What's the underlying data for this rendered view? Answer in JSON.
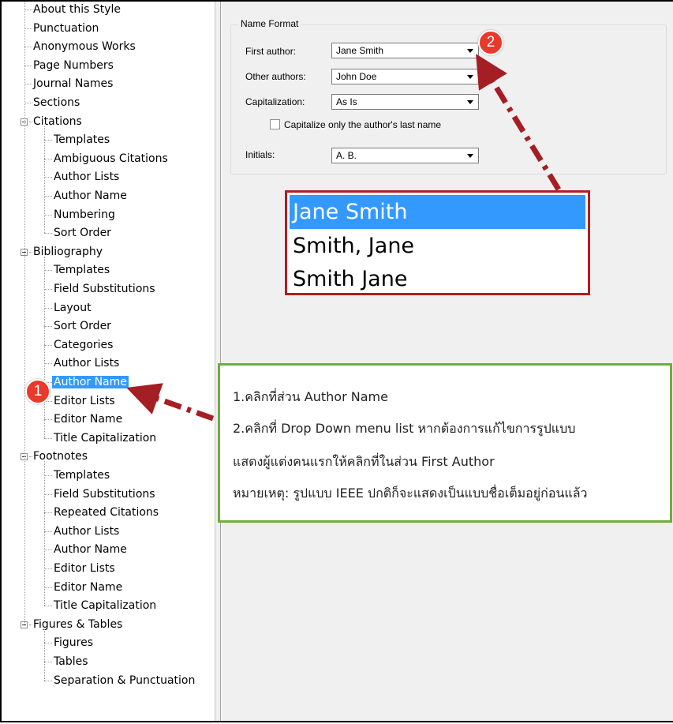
{
  "tree": {
    "items": [
      {
        "label": "About this Style",
        "level": 0
      },
      {
        "label": "Punctuation",
        "level": 0
      },
      {
        "label": "Anonymous Works",
        "level": 0
      },
      {
        "label": "Page Numbers",
        "level": 0
      },
      {
        "label": "Journal Names",
        "level": 0
      },
      {
        "label": "Sections",
        "level": 0
      },
      {
        "label": "Citations",
        "level": 0,
        "expanded": true
      },
      {
        "label": "Templates",
        "level": 1
      },
      {
        "label": "Ambiguous Citations",
        "level": 1
      },
      {
        "label": "Author Lists",
        "level": 1
      },
      {
        "label": "Author Name",
        "level": 1
      },
      {
        "label": "Numbering",
        "level": 1
      },
      {
        "label": "Sort Order",
        "level": 1
      },
      {
        "label": "Bibliography",
        "level": 0,
        "expanded": true
      },
      {
        "label": "Templates",
        "level": 1
      },
      {
        "label": "Field Substitutions",
        "level": 1
      },
      {
        "label": "Layout",
        "level": 1
      },
      {
        "label": "Sort Order",
        "level": 1
      },
      {
        "label": "Categories",
        "level": 1
      },
      {
        "label": "Author Lists",
        "level": 1
      },
      {
        "label": "Author Name",
        "level": 1,
        "selected": true
      },
      {
        "label": "Editor Lists",
        "level": 1
      },
      {
        "label": "Editor Name",
        "level": 1
      },
      {
        "label": "Title Capitalization",
        "level": 1
      },
      {
        "label": "Footnotes",
        "level": 0,
        "expanded": true
      },
      {
        "label": "Templates",
        "level": 1
      },
      {
        "label": "Field Substitutions",
        "level": 1
      },
      {
        "label": "Repeated Citations",
        "level": 1
      },
      {
        "label": "Author Lists",
        "level": 1
      },
      {
        "label": "Author Name",
        "level": 1
      },
      {
        "label": "Editor Lists",
        "level": 1
      },
      {
        "label": "Editor Name",
        "level": 1
      },
      {
        "label": "Title Capitalization",
        "level": 1
      },
      {
        "label": "Figures & Tables",
        "level": 0,
        "expanded": true
      },
      {
        "label": "Figures",
        "level": 1
      },
      {
        "label": "Tables",
        "level": 1
      },
      {
        "label": "Separation & Punctuation",
        "level": 1
      }
    ]
  },
  "name_format": {
    "title": "Name Format",
    "first_author_label": "First author:",
    "first_author_value": "Jane Smith",
    "other_authors_label": "Other authors:",
    "other_authors_value": "John Doe",
    "capitalization_label": "Capitalization:",
    "capitalization_value": "As Is",
    "capitalize_last_label": "Capitalize only the author's last name",
    "capitalize_last_checked": false,
    "initials_label": "Initials:",
    "initials_value": "A. B."
  },
  "dropdown_options": [
    "Jane Smith",
    "Smith, Jane",
    "Smith Jane"
  ],
  "badges": {
    "one": "1",
    "two": "2"
  },
  "note": {
    "line1": "1.คลิกที่ส่วน Author Name",
    "line2": "2.คลิกที่ Drop Down menu list หากต้องการแก้ไขการรูปแบบ",
    "line3": "แสดงผู้แต่งคนแรกให้คลิกที่ในส่วน First Author",
    "line4": "หมายเหตุ: รูปแบบ IEEE ปกติก็จะแสดงเป็นแบบชื่อเต็มอยู่ก่อนแล้ว"
  },
  "colors": {
    "selection": "#3399ff",
    "callout_red": "#b01e23",
    "arrow_red": "#a51e23",
    "badge_red": "#e8392c",
    "note_border": "#6fae3c"
  }
}
